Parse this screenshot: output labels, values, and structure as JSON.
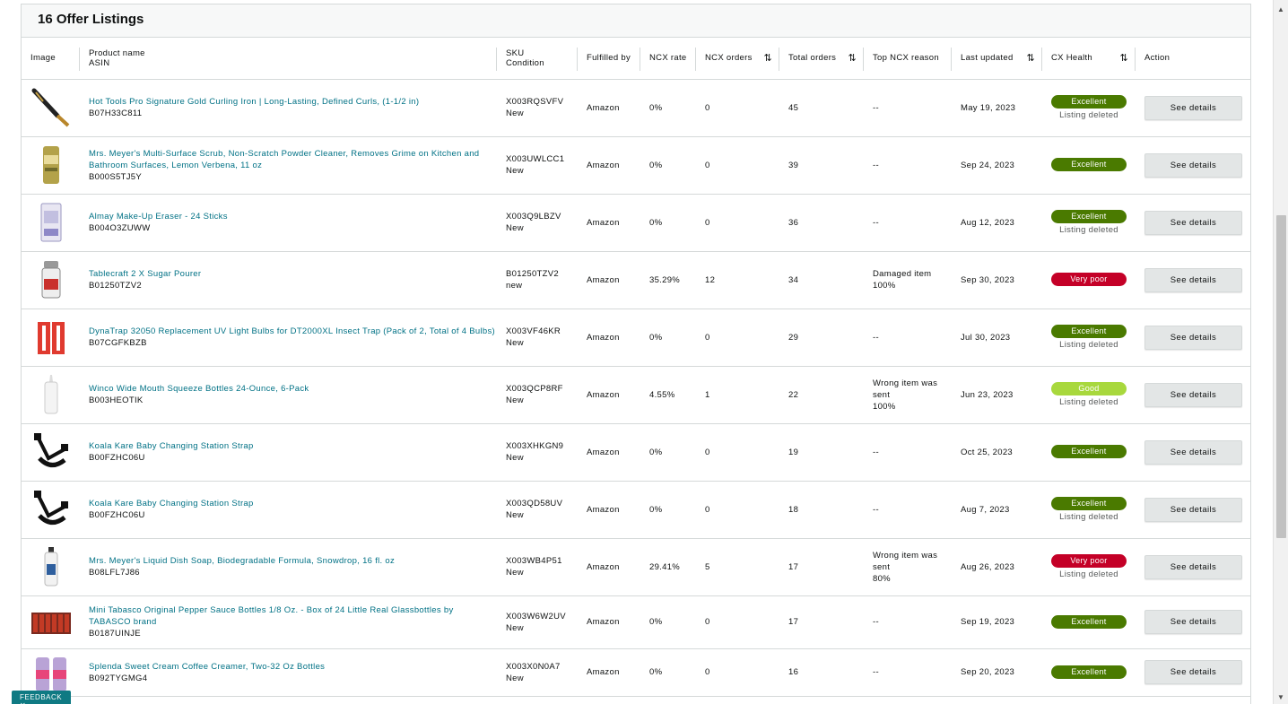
{
  "panel": {
    "title": "16 Offer Listings"
  },
  "columns": {
    "image": "Image",
    "product_name": "Product name",
    "asin": "ASIN",
    "sku": "SKU",
    "condition": "Condition",
    "fulfilled_by": "Fulfilled by",
    "ncx_rate": "NCX rate",
    "ncx_orders": "NCX orders",
    "total_orders": "Total orders",
    "top_ncx_reason": "Top NCX reason",
    "last_updated": "Last updated",
    "cx_health": "CX Health",
    "action": "Action"
  },
  "colors": {
    "link": "#007185",
    "excellent": "#4a7a00",
    "very_poor": "#c40027",
    "good": "#a8d83d"
  },
  "rows": [
    {
      "name": "Hot Tools Pro Signature Gold Curling Iron | Long-Lasting, Defined Curls, (1-1/2 in)",
      "asin": "B07H33C811",
      "sku": "X003RQSVFV",
      "condition": "New",
      "fulfilled": "Amazon",
      "ncx_rate": "0%",
      "ncx_orders": "0",
      "total": "45",
      "reason": "--",
      "reason_pct": "",
      "updated": "May 19, 2023",
      "health": "Excellent",
      "deleted": "Listing deleted",
      "action": "See details",
      "icon": "curling-iron-icon"
    },
    {
      "name": "Mrs. Meyer's Multi-Surface Scrub, Non-Scratch Powder Cleaner, Removes Grime on Kitchen and Bathroom Surfaces, Lemon Verbena, 11 oz",
      "asin": "B000S5TJ5Y",
      "sku": "X003UWLCC1",
      "condition": "New",
      "fulfilled": "Amazon",
      "ncx_rate": "0%",
      "ncx_orders": "0",
      "total": "39",
      "reason": "--",
      "reason_pct": "",
      "updated": "Sep 24, 2023",
      "health": "Excellent",
      "deleted": "",
      "action": "See details",
      "icon": "cleaner-can-icon"
    },
    {
      "name": "Almay Make-Up Eraser - 24 Sticks",
      "asin": "B004O3ZUWW",
      "sku": "X003Q9LBZV",
      "condition": "New",
      "fulfilled": "Amazon",
      "ncx_rate": "0%",
      "ncx_orders": "0",
      "total": "36",
      "reason": "--",
      "reason_pct": "",
      "updated": "Aug 12, 2023",
      "health": "Excellent",
      "deleted": "Listing deleted",
      "action": "See details",
      "icon": "makeup-box-icon"
    },
    {
      "name": "Tablecraft 2 X Sugar Pourer",
      "asin": "B01250TZV2",
      "sku": "B01250TZV2",
      "condition": "new",
      "fulfilled": "Amazon",
      "ncx_rate": "35.29%",
      "ncx_orders": "12",
      "total": "34",
      "reason": "Damaged item",
      "reason_pct": "100%",
      "updated": "Sep 30, 2023",
      "health": "Very poor",
      "deleted": "",
      "action": "See details",
      "icon": "sugar-pourer-icon"
    },
    {
      "name": "DynaTrap 32050 Replacement UV Light Bulbs for DT2000XL Insect Trap (Pack of 2, Total of 4 Bulbs)",
      "asin": "B07CGFKBZB",
      "sku": "X003VF46KR",
      "condition": "New",
      "fulfilled": "Amazon",
      "ncx_rate": "0%",
      "ncx_orders": "0",
      "total": "29",
      "reason": "--",
      "reason_pct": "",
      "updated": "Jul 30, 2023",
      "health": "Excellent",
      "deleted": "Listing deleted",
      "action": "See details",
      "icon": "bulb-pack-icon"
    },
    {
      "name": "Winco Wide Mouth Squeeze Bottles 24-Ounce, 6-Pack",
      "asin": "B003HEOTIK",
      "sku": "X003QCP8RF",
      "condition": "New",
      "fulfilled": "Amazon",
      "ncx_rate": "4.55%",
      "ncx_orders": "1",
      "total": "22",
      "reason": "Wrong item was sent",
      "reason_pct": "100%",
      "updated": "Jun 23, 2023",
      "health": "Good",
      "deleted": "Listing deleted",
      "action": "See details",
      "icon": "squeeze-bottle-icon"
    },
    {
      "name": "Koala Kare Baby Changing Station Strap",
      "asin": "B00FZHC06U",
      "sku": "X003XHKGN9",
      "condition": "New",
      "fulfilled": "Amazon",
      "ncx_rate": "0%",
      "ncx_orders": "0",
      "total": "19",
      "reason": "--",
      "reason_pct": "",
      "updated": "Oct 25, 2023",
      "health": "Excellent",
      "deleted": "",
      "action": "See details",
      "icon": "strap-icon"
    },
    {
      "name": "Koala Kare Baby Changing Station Strap",
      "asin": "B00FZHC06U",
      "sku": "X003QD58UV",
      "condition": "New",
      "fulfilled": "Amazon",
      "ncx_rate": "0%",
      "ncx_orders": "0",
      "total": "18",
      "reason": "--",
      "reason_pct": "",
      "updated": "Aug 7, 2023",
      "health": "Excellent",
      "deleted": "Listing deleted",
      "action": "See details",
      "icon": "strap-icon"
    },
    {
      "name": "Mrs. Meyer's Liquid Dish Soap, Biodegradable Formula, Snowdrop, 16 fl. oz",
      "asin": "B08LFL7J86",
      "sku": "X003WB4P51",
      "condition": "New",
      "fulfilled": "Amazon",
      "ncx_rate": "29.41%",
      "ncx_orders": "5",
      "total": "17",
      "reason": "Wrong item was sent",
      "reason_pct": "80%",
      "updated": "Aug 26, 2023",
      "health": "Very poor",
      "deleted": "Listing deleted",
      "action": "See details",
      "icon": "soap-bottle-icon"
    },
    {
      "name": "Mini Tabasco Original Pepper Sauce Bottles 1/8 Oz. - Box of 24 Little Real Glassbottles by TABASCO brand",
      "asin": "B0187UINJE",
      "sku": "X003W6W2UV",
      "condition": "New",
      "fulfilled": "Amazon",
      "ncx_rate": "0%",
      "ncx_orders": "0",
      "total": "17",
      "reason": "--",
      "reason_pct": "",
      "updated": "Sep 19, 2023",
      "health": "Excellent",
      "deleted": "",
      "action": "See details",
      "icon": "sauce-box-icon"
    },
    {
      "name": "Splenda Sweet Cream Coffee Creamer, Two-32 Oz Bottles",
      "asin": "B092TYGMG4",
      "sku": "X003X0N0A7",
      "condition": "New",
      "fulfilled": "Amazon",
      "ncx_rate": "0%",
      "ncx_orders": "0",
      "total": "16",
      "reason": "--",
      "reason_pct": "",
      "updated": "Sep 20, 2023",
      "health": "Excellent",
      "deleted": "",
      "action": "See details",
      "icon": "creamer-bottles-icon"
    }
  ],
  "feedback": {
    "label": "FEEDBACK",
    "close": "✕"
  }
}
